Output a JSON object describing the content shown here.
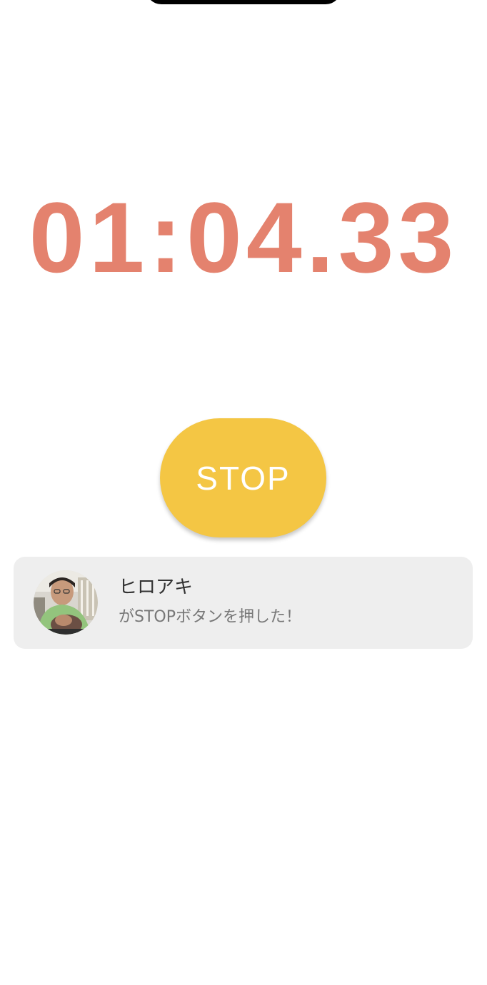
{
  "timer": {
    "display": "01:04.33"
  },
  "stop_button": {
    "label": "STOP"
  },
  "notification": {
    "user_name": "ヒロアキ",
    "message": "がSTOPボタンを押した！"
  },
  "colors": {
    "timer": "#e4826e",
    "stop_button": "#f4c644",
    "card_background": "#eeeeee"
  }
}
